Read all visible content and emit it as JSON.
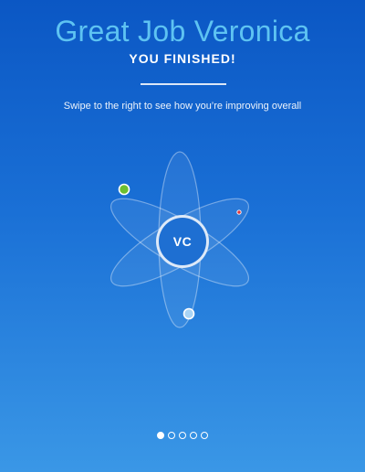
{
  "header": {
    "title": "Great Job Veronica",
    "subtitle": "YOU FINISHED!",
    "instruction": "Swipe to the right to see how you’re improving overall"
  },
  "avatar": {
    "initials": "VC"
  },
  "orbit": {
    "markers": [
      {
        "name": "green-marker",
        "color": "#6cbf2f"
      },
      {
        "name": "red-marker",
        "color": "#e0343a"
      },
      {
        "name": "blue-marker",
        "color": "#a9d4f5"
      }
    ]
  },
  "pager": {
    "page_count": 5,
    "active_index": 0
  },
  "colors": {
    "background_top": "#0b57c4",
    "background_bottom": "#3a97e6",
    "title_accent": "#5ec3f2"
  }
}
